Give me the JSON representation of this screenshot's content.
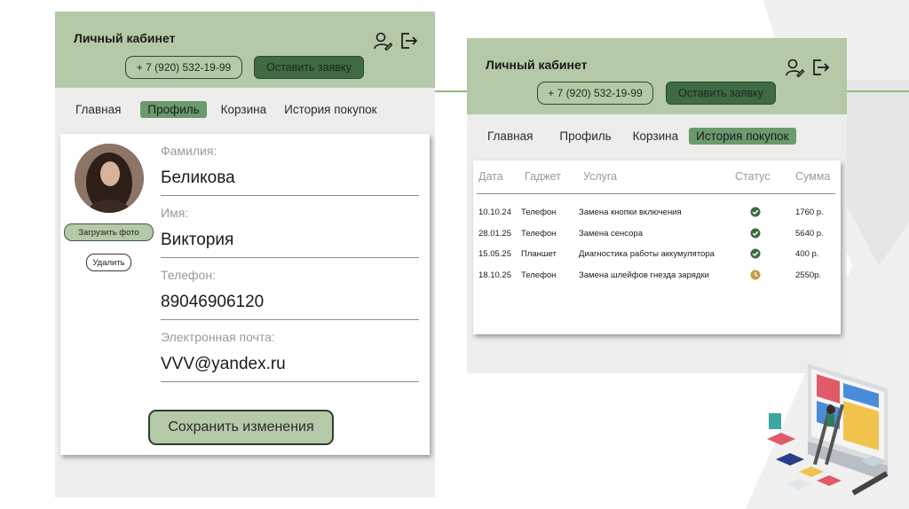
{
  "left_panel": {
    "header": {
      "title": "Личный кабинет",
      "phone": "+ 7 (920) 532-19-99",
      "order_button": "Оставить заявку",
      "icons": [
        "user-edit-icon",
        "logout-icon"
      ]
    },
    "nav": {
      "items": [
        {
          "label": "Главная",
          "active": false
        },
        {
          "label": "Профиль",
          "active": true
        },
        {
          "label": "Корзина",
          "active": false
        },
        {
          "label": "История покупок",
          "active": false
        }
      ]
    },
    "profile": {
      "upload_photo": "Загрузить фото",
      "delete": "Удалить",
      "fields": [
        {
          "label": "Фамилия:",
          "value": "Беликова"
        },
        {
          "label": "Имя:",
          "value": "Виктория"
        },
        {
          "label": "Телефон:",
          "value": "89046906120"
        },
        {
          "label": "Электронная почта:",
          "value": "VVV@yandex.ru"
        }
      ],
      "save_button": "Сохранить изменения"
    }
  },
  "right_panel": {
    "header": {
      "title": "Личный кабинет",
      "phone": "+ 7 (920) 532-19-99",
      "order_button": "Оставить заявку",
      "icons": [
        "user-edit-icon",
        "logout-icon"
      ]
    },
    "nav": {
      "items": [
        {
          "label": "Главная",
          "active": false
        },
        {
          "label": "Профиль",
          "active": false
        },
        {
          "label": "Корзина",
          "active": false
        },
        {
          "label": "История покупок",
          "active": true
        }
      ]
    },
    "table": {
      "columns": [
        "Дата",
        "Гаджет",
        "Услуга",
        "Статус",
        "Сумма"
      ],
      "rows": [
        {
          "date": "10.10.24",
          "gadget": "Телефон",
          "service": "Замена кнопки включения",
          "status": "done",
          "sum": "1760 р."
        },
        {
          "date": "28.01.25",
          "gadget": "Телефон",
          "service": "Замена сенсора",
          "status": "done",
          "sum": "5640 р."
        },
        {
          "date": "15.05.25",
          "gadget": "Планшет",
          "service": "Диагностика работы аккумулятора",
          "status": "done",
          "sum": "400 р."
        },
        {
          "date": "18.10.25",
          "gadget": "Телефон",
          "service": "Замена шлейфов гнезда зарядки",
          "status": "pending",
          "sum": "2550р."
        }
      ]
    }
  },
  "colors": {
    "header_bg": "#b4c9a7",
    "accent_dark": "#3f6a43",
    "nav_active": "#6a9a6e",
    "status_done": "#3b6b3e",
    "status_pending": "#c79a4a"
  }
}
